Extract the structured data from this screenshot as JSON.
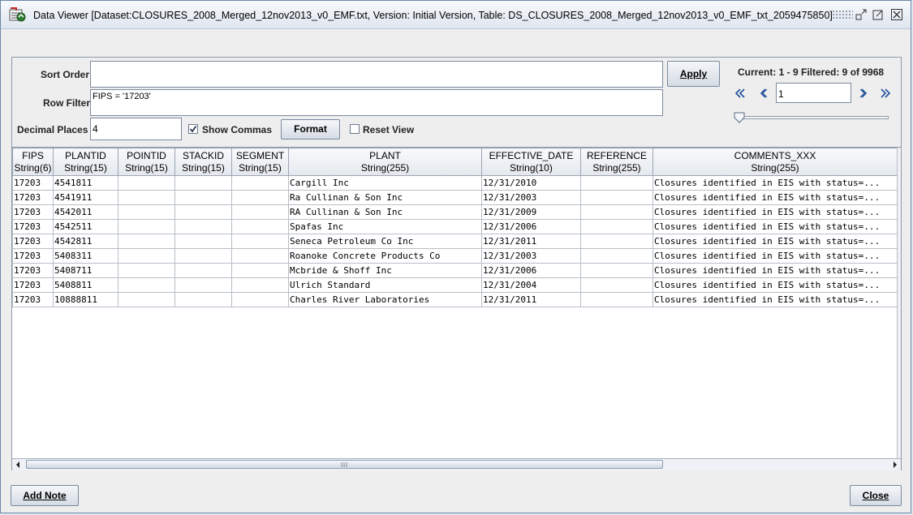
{
  "window": {
    "title": "Data Viewer [Dataset:CLOSURES_2008_Merged_12nov2013_v0_EMF.txt, Version: Initial Version, Table: DS_CLOSURES_2008_Merged_12nov2013_v0_EMF_txt_2059475850]"
  },
  "controls": {
    "sort_order_label": "Sort Order",
    "sort_order_value": "",
    "row_filter_label": "Row Filter",
    "row_filter_value": "FIPS = '17203'",
    "decimal_places_label": "Decimal Places",
    "decimal_places_value": "4",
    "show_commas_label": "Show Commas",
    "show_commas_checked": true,
    "format_label": "Format",
    "reset_view_label": "Reset View",
    "reset_view_checked": false,
    "apply_label": "Apply"
  },
  "pager": {
    "status": "Current: 1 - 9 Filtered: 9 of 9968",
    "page_value": "1"
  },
  "table": {
    "columns": [
      {
        "name": "FIPS",
        "type": "String(6)"
      },
      {
        "name": "PLANTID",
        "type": "String(15)"
      },
      {
        "name": "POINTID",
        "type": "String(15)"
      },
      {
        "name": "STACKID",
        "type": "String(15)"
      },
      {
        "name": "SEGMENT",
        "type": "String(15)"
      },
      {
        "name": "PLANT",
        "type": "String(255)"
      },
      {
        "name": "EFFECTIVE_DATE",
        "type": "String(10)"
      },
      {
        "name": "REFERENCE",
        "type": "String(255)"
      },
      {
        "name": "COMMENTS_XXX",
        "type": "String(255)"
      }
    ],
    "rows": [
      [
        "17203",
        "4541811",
        "",
        "",
        "",
        "Cargill Inc",
        "12/31/2010",
        "",
        "Closures identified in EIS with status=..."
      ],
      [
        "17203",
        "4541911",
        "",
        "",
        "",
        "Ra Cullinan & Son Inc",
        "12/31/2003",
        "",
        "Closures identified in EIS with status=..."
      ],
      [
        "17203",
        "4542011",
        "",
        "",
        "",
        "RA Cullinan & Son Inc",
        "12/31/2009",
        "",
        "Closures identified in EIS with status=..."
      ],
      [
        "17203",
        "4542511",
        "",
        "",
        "",
        "Spafas Inc",
        "12/31/2006",
        "",
        "Closures identified in EIS with status=..."
      ],
      [
        "17203",
        "4542811",
        "",
        "",
        "",
        "Seneca Petroleum Co Inc",
        "12/31/2011",
        "",
        "Closures identified in EIS with status=..."
      ],
      [
        "17203",
        "5408311",
        "",
        "",
        "",
        "Roanoke Concrete Products Co",
        "12/31/2003",
        "",
        "Closures identified in EIS with status=..."
      ],
      [
        "17203",
        "5408711",
        "",
        "",
        "",
        "Mcbride & Shoff Inc",
        "12/31/2006",
        "",
        "Closures identified in EIS with status=..."
      ],
      [
        "17203",
        "5408811",
        "",
        "",
        "",
        "Ulrich Standard",
        "12/31/2004",
        "",
        "Closures identified in EIS with status=..."
      ],
      [
        "17203",
        "10888811",
        "",
        "",
        "",
        "Charles River Laboratories",
        "12/31/2011",
        "",
        "Closures identified in EIS with status=..."
      ]
    ]
  },
  "footer": {
    "add_note_label": "Add Note",
    "close_label": "Close"
  },
  "colors": {
    "accent": "#1f4f9a",
    "frame": "#6d86a8"
  }
}
